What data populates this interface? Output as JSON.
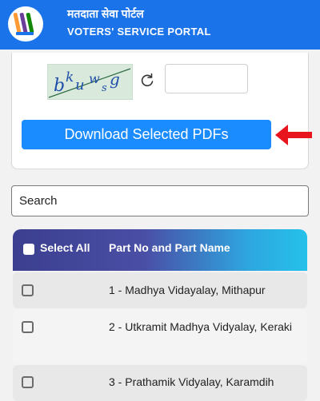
{
  "header": {
    "title_hindi": "मतदाता सेवा पोर्टल",
    "title_english": "VOTERS' SERVICE PORTAL"
  },
  "captcha": {
    "text": "bkuwsg",
    "input_value": ""
  },
  "download_button": {
    "label": "Download Selected PDFs"
  },
  "search": {
    "placeholder": "Search"
  },
  "table": {
    "select_all_label": "Select All",
    "column_label": "Part No and Part Name",
    "rows": [
      {
        "text": "1 - Madhya Vidayalay, Mithapur"
      },
      {
        "text": "2 - Utkramit Madhya Vidyalay, Keraki"
      },
      {
        "text": "3 - Prathamik Vidyalay, Karamdih"
      }
    ]
  },
  "colors": {
    "header_bg": "#1a73e8",
    "button_bg": "#1a8cff",
    "arrow": "#e8141e",
    "row_odd_bg": "#e8e8e8",
    "row_even_bg": "#f4f4f4"
  }
}
